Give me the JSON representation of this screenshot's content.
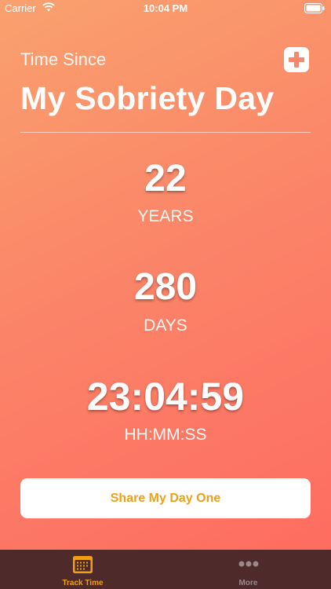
{
  "status_bar": {
    "carrier": "Carrier",
    "time": "10:04 PM"
  },
  "header": {
    "subtitle": "Time Since",
    "title": "My Sobriety Day"
  },
  "stats": {
    "years": {
      "value": "22",
      "label": "YEARS"
    },
    "days": {
      "value": "280",
      "label": "DAYS"
    },
    "clock": {
      "value": "23:04:59",
      "label": "HH:MM:SS"
    }
  },
  "share_button": {
    "label": "Share My Day One"
  },
  "tab_bar": {
    "tabs": [
      {
        "label": "Track Time",
        "icon": "calendar-icon",
        "selected": true
      },
      {
        "label": "More",
        "icon": "more-dots-icon",
        "selected": false
      }
    ],
    "active_color": "#f0a017",
    "background": "#4e2a2b"
  },
  "colors": {
    "gradient_start": "#f9a16e",
    "gradient_end": "#fe6a5f",
    "accent": "#f0a017"
  }
}
